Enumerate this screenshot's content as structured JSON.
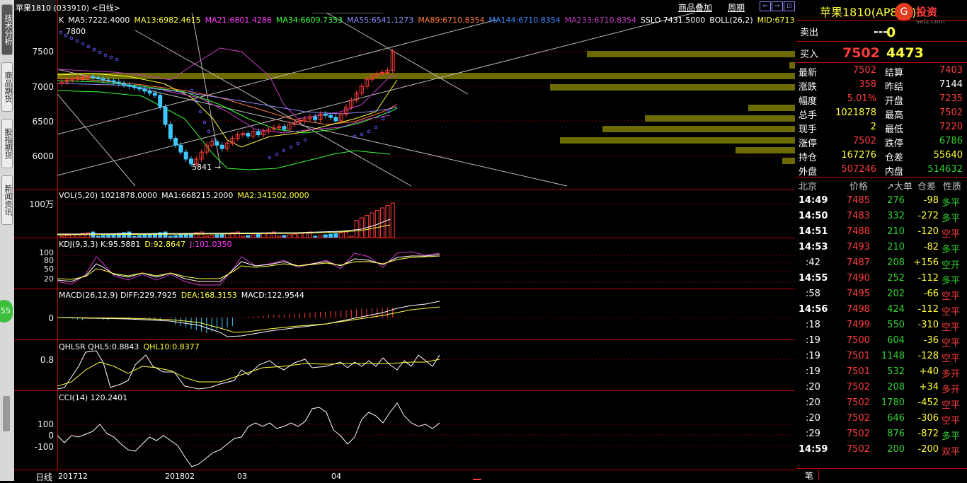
{
  "left_tabs": [
    "技术分析",
    "商品期货",
    "股指期货",
    "新闻资讯"
  ],
  "left_badge": "55",
  "chart": {
    "title": "苹果1810 (033910) <日线>",
    "top_buttons": [
      "商品叠加",
      "周期"
    ],
    "ma_legend": [
      {
        "text": "K",
        "color": "#ffffff"
      },
      {
        "text": "MA5:7222.4000",
        "color": "#ffffff"
      },
      {
        "text": "MA13:6982.4615",
        "color": "#ffff3c"
      },
      {
        "text": "MA21:6801.4286",
        "color": "#ff3cff"
      },
      {
        "text": "MA34:6609.7353",
        "color": "#3cff3c"
      },
      {
        "text": "MA55:6541.1273",
        "color": "#8c8cff"
      },
      {
        "text": "MA89:6710.8354",
        "color": "#ff7a3c"
      },
      {
        "text": "MA144:6710.8354",
        "color": "#3c8cff"
      },
      {
        "text": "MA233:6710.8354",
        "color": "#c83cc8"
      },
      {
        "text": "SSLO  7431.5000",
        "color": "#ffffff"
      },
      {
        "text": "BOLL(26,2)",
        "color": "#ffffff"
      },
      {
        "text": "MID:6713",
        "color": "#ffff3c"
      }
    ],
    "high_mark": "7800",
    "low_mark": "5841",
    "price_axis": [
      "7500",
      "7000",
      "6500",
      "6000"
    ],
    "vol_legend": [
      {
        "text": "VOL(5,20)  1021878.0000",
        "color": "#ffffff"
      },
      {
        "text": "MA1:668215.2000",
        "color": "#ffffff"
      },
      {
        "text": "MA2:341502.0000",
        "color": "#ffff3c"
      }
    ],
    "vol_axis": "100万",
    "kdj_legend": [
      {
        "text": "KDJ(9,3,3)  K:95.5881",
        "color": "#ffffff"
      },
      {
        "text": "D:92.8647",
        "color": "#ffff3c"
      },
      {
        "text": "J:101.0350",
        "color": "#ff3cff"
      }
    ],
    "kdj_axis": [
      "100",
      "80",
      "50",
      "20"
    ],
    "macd_legend": [
      {
        "text": "MACD(26,12,9)  DIFF:229.7925",
        "color": "#ffffff"
      },
      {
        "text": "DEA:168.3153",
        "color": "#ffff3c"
      },
      {
        "text": "MACD:122.9544",
        "color": "#ffffff"
      }
    ],
    "macd_axis": "0",
    "qhl_legend": [
      {
        "text": "QHLSR  QHL5:0.8843",
        "color": "#ffffff"
      },
      {
        "text": "QHL10:0.8377",
        "color": "#ffff3c"
      }
    ],
    "qhl_axis": "0.8",
    "cci_legend": [
      {
        "text": "CCI(14)  120.2401",
        "color": "#ffffff"
      }
    ],
    "cci_axis": [
      "100",
      "0",
      "-100"
    ],
    "period_label": "日线",
    "date_ticks": [
      "201712",
      "201802",
      "03",
      "04"
    ]
  },
  "quote": {
    "name": "苹果1810(AP810)",
    "watermark": "投资",
    "watermark_sub": "setz.com",
    "sell_label": "卖出",
    "sell_price": "---",
    "sell_vol": "0",
    "buy_label": "买入",
    "buy_price": "7502",
    "buy_vol": "4473",
    "fields": [
      {
        "l1": "最新",
        "v1": "7502",
        "c1": "red",
        "l2": "结算",
        "v2": "7403",
        "c2": "red"
      },
      {
        "l1": "涨跌",
        "v1": "358",
        "c1": "red",
        "l2": "昨结",
        "v2": "7144",
        "c2": "white"
      },
      {
        "l1": "幅度",
        "v1": "5.01%",
        "c1": "red",
        "l2": "开盘",
        "v2": "7235",
        "c2": "red"
      },
      {
        "l1": "总手",
        "v1": "1021878",
        "c1": "yellow",
        "l2": "最高",
        "v2": "7502",
        "c2": "red"
      },
      {
        "l1": "现手",
        "v1": "2",
        "c1": "yellow",
        "l2": "最低",
        "v2": "7220",
        "c2": "red"
      },
      {
        "l1": "涨停",
        "v1": "7502",
        "c1": "red",
        "l2": "跌停",
        "v2": "6786",
        "c2": "green"
      },
      {
        "l1": "持仓",
        "v1": "167276",
        "c1": "yellow",
        "l2": "仓差",
        "v2": "55640",
        "c2": "yellow"
      },
      {
        "l1": "外盘",
        "v1": "507246",
        "c1": "red",
        "l2": "内盘",
        "v2": "514632",
        "c2": "green"
      }
    ],
    "tick_headers": [
      "北京",
      "价格",
      "↗大单",
      "仓差",
      "性质"
    ],
    "ticks": [
      {
        "time": "14:49",
        "price": "7485",
        "vol": "276",
        "diff": "-98",
        "type": "多平",
        "tc": "green"
      },
      {
        "time": "14:50",
        "price": "7483",
        "vol": "332",
        "diff": "-272",
        "type": "多平",
        "tc": "green"
      },
      {
        "time": "14:51",
        "price": "7488",
        "vol": "210",
        "diff": "-120",
        "type": "空平",
        "tc": "red"
      },
      {
        "time": "14:53",
        "price": "7493",
        "vol": "210",
        "diff": "-82",
        "type": "多平",
        "tc": "green"
      },
      {
        "time": ":42",
        "price": "7487",
        "vol": "208",
        "diff": "+156",
        "type": "空开",
        "tc": "green"
      },
      {
        "time": "14:55",
        "price": "7490",
        "vol": "252",
        "diff": "-112",
        "type": "多平",
        "tc": "green"
      },
      {
        "time": ":58",
        "price": "7495",
        "vol": "202",
        "diff": "-66",
        "type": "空平",
        "tc": "red"
      },
      {
        "time": "14:56",
        "price": "7498",
        "vol": "424",
        "diff": "-112",
        "type": "空平",
        "tc": "red"
      },
      {
        "time": ":18",
        "price": "7499",
        "vol": "550",
        "diff": "-310",
        "type": "空平",
        "tc": "red"
      },
      {
        "time": ":19",
        "price": "7500",
        "vol": "604",
        "diff": "-36",
        "type": "空平",
        "tc": "red"
      },
      {
        "time": ":19",
        "price": "7501",
        "vol": "1148",
        "diff": "-128",
        "type": "空平",
        "tc": "red"
      },
      {
        "time": ":19",
        "price": "7501",
        "vol": "532",
        "diff": "+40",
        "type": "多开",
        "tc": "red"
      },
      {
        "time": ":20",
        "price": "7502",
        "vol": "208",
        "diff": "+34",
        "type": "多开",
        "tc": "red"
      },
      {
        "time": ":20",
        "price": "7502",
        "vol": "1780",
        "diff": "-452",
        "type": "空平",
        "tc": "red"
      },
      {
        "time": ":20",
        "price": "7502",
        "vol": "646",
        "diff": "-306",
        "type": "空平",
        "tc": "red"
      },
      {
        "time": ":29",
        "price": "7502",
        "vol": "876",
        "diff": "-872",
        "type": "多平",
        "tc": "green"
      },
      {
        "time": "14:59",
        "price": "7502",
        "vol": "200",
        "diff": "-200",
        "type": "双平",
        "tc": "red"
      }
    ],
    "bottom_tab": "笔"
  }
}
